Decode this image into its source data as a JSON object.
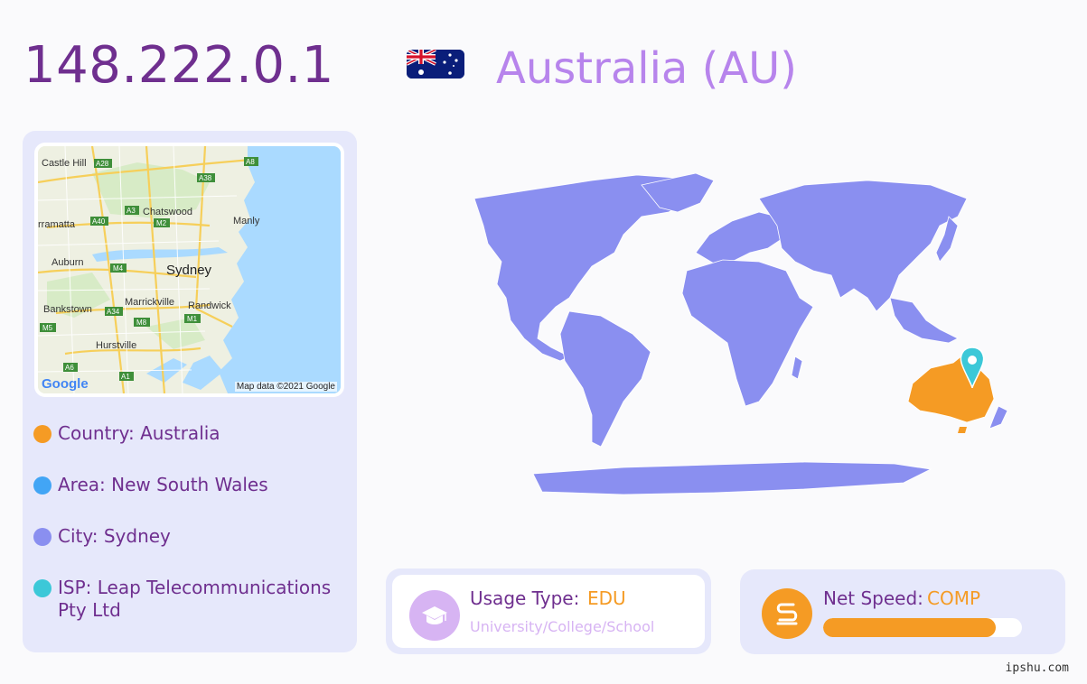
{
  "header": {
    "ip": "148.222.0.1",
    "country_title": "Australia (AU)",
    "flag_icon": "australia-flag"
  },
  "map": {
    "credit": "Map data ©2021 Google",
    "logo": "Google",
    "labels": [
      "Castle Hill",
      "Chatswood",
      "Manly",
      "rramatta",
      "Auburn",
      "Sydney",
      "Marrickville",
      "Randwick",
      "Bankstown",
      "Hurstville"
    ],
    "road_labels": [
      "A28",
      "A38",
      "A8",
      "A3",
      "M2",
      "A40",
      "M4",
      "A34",
      "M8",
      "M1",
      "M5",
      "A6",
      "A1"
    ]
  },
  "info": {
    "country": "Country: Australia",
    "area": "Area: New South Wales",
    "city": "City: Sydney",
    "isp": "ISP: Leap Telecommunications Pty Ltd"
  },
  "usage": {
    "label": "Usage Type:",
    "value": "EDU",
    "sub": "University/College/School",
    "icon": "graduation-cap-icon"
  },
  "speed": {
    "label": "Net Speed:",
    "value": "COMP",
    "level": 0.87,
    "icon": "speed-s-icon"
  },
  "footer": {
    "watermark": "ipshu.com"
  },
  "colors": {
    "ip": "#6f2f8f",
    "title": "#b784ec",
    "country_dot": "#f59b24",
    "area_dot": "#42a5f5",
    "city_dot": "#8a8ff0",
    "isp_dot": "#3cc8d8",
    "world_land": "#8a8ff0",
    "highlight_country": "#f59b24",
    "pin": "#3cc8d8"
  }
}
